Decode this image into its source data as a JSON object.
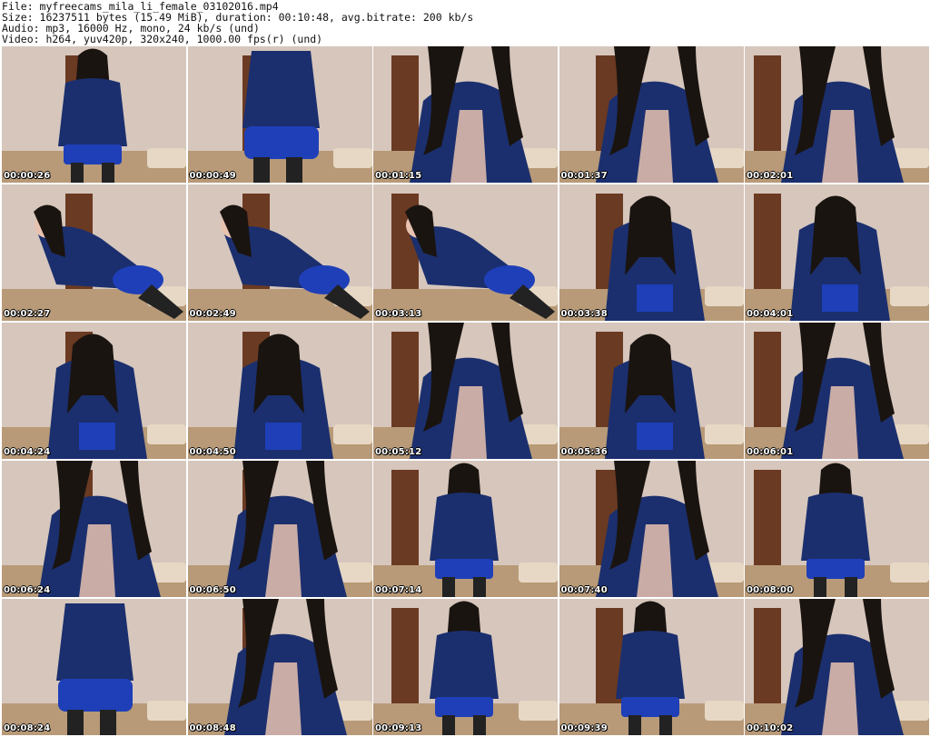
{
  "header": {
    "file_line": "File: myfreecams_mila_li_female_03102016.mp4",
    "size_line": "Size: 16237511 bytes (15.49 MiB), duration: 00:10:48, avg.bitrate: 200 kb/s",
    "audio_line": "Audio: mp3, 16000 Hz, mono, 24 kb/s (und)",
    "video_line": "Video: h264, yuv420p, 320x240, 1000.00 fps(r) (und)"
  },
  "thumbnails": [
    {
      "timestamp": "00:00:26",
      "pose": "stand-front"
    },
    {
      "timestamp": "00:00:49",
      "pose": "back"
    },
    {
      "timestamp": "00:01:15",
      "pose": "close"
    },
    {
      "timestamp": "00:01:37",
      "pose": "close"
    },
    {
      "timestamp": "00:02:01",
      "pose": "close"
    },
    {
      "timestamp": "00:02:27",
      "pose": "kneel"
    },
    {
      "timestamp": "00:02:49",
      "pose": "crawl"
    },
    {
      "timestamp": "00:03:13",
      "pose": "crawl"
    },
    {
      "timestamp": "00:03:38",
      "pose": "lean"
    },
    {
      "timestamp": "00:04:01",
      "pose": "lean"
    },
    {
      "timestamp": "00:04:24",
      "pose": "lean"
    },
    {
      "timestamp": "00:04:50",
      "pose": "lean"
    },
    {
      "timestamp": "00:05:12",
      "pose": "close"
    },
    {
      "timestamp": "00:05:36",
      "pose": "lean"
    },
    {
      "timestamp": "00:06:01",
      "pose": "close"
    },
    {
      "timestamp": "00:06:24",
      "pose": "close"
    },
    {
      "timestamp": "00:06:50",
      "pose": "close"
    },
    {
      "timestamp": "00:07:14",
      "pose": "stand-front"
    },
    {
      "timestamp": "00:07:40",
      "pose": "close"
    },
    {
      "timestamp": "00:08:00",
      "pose": "stand-front"
    },
    {
      "timestamp": "00:08:24",
      "pose": "back"
    },
    {
      "timestamp": "00:08:48",
      "pose": "close"
    },
    {
      "timestamp": "00:09:13",
      "pose": "stand-front"
    },
    {
      "timestamp": "00:09:39",
      "pose": "stand-front"
    },
    {
      "timestamp": "00:10:02",
      "pose": "close"
    }
  ],
  "colors": {
    "wall": "#d6c6bc",
    "door": "#6b3a22",
    "bed": "#b89a78",
    "jacket": "#1b2f6e",
    "skirt": "#1f3fb8",
    "hair": "#1a1410",
    "skin": "#e8c2b0"
  }
}
